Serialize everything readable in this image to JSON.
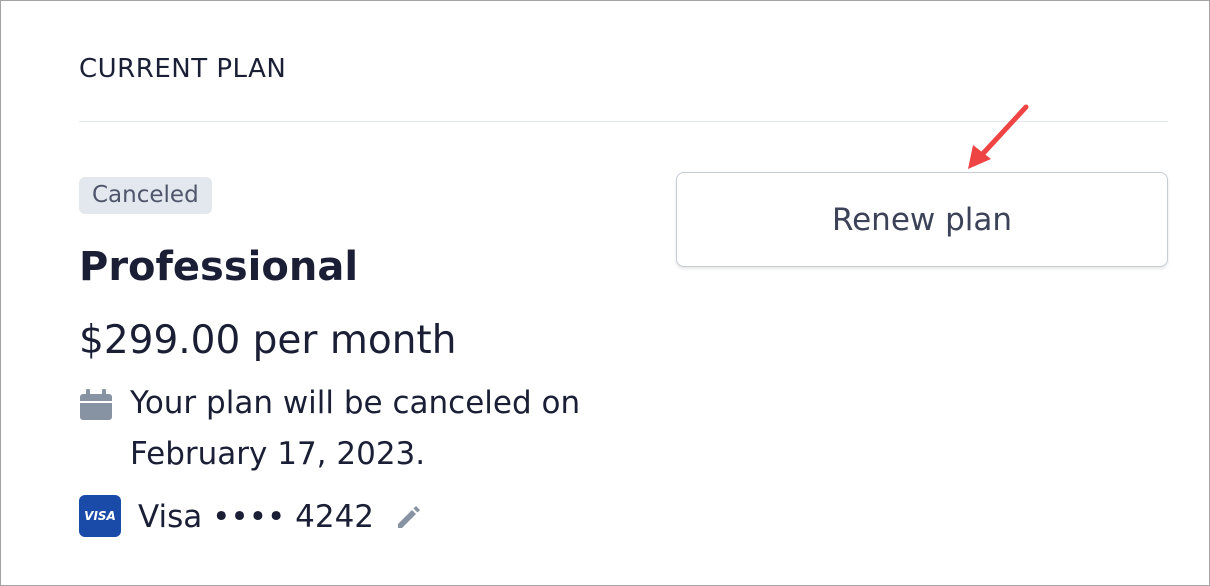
{
  "section": {
    "title": "CURRENT PLAN"
  },
  "plan": {
    "status_badge": "Canceled",
    "name": "Professional",
    "price": "$299.00 per month",
    "cancel_notice": "Your plan will be canceled on February 17, 2023."
  },
  "payment": {
    "card_brand_logo_text": "VISA",
    "card_label": "Visa •••• 4242"
  },
  "actions": {
    "renew_label": "Renew plan"
  },
  "icons": {
    "calendar": "calendar-icon",
    "edit": "pencil-icon",
    "arrow": "annotation-arrow"
  },
  "colors": {
    "text": "#1a1f36",
    "muted": "#4f566b",
    "badge_bg": "#e3e8ee",
    "visa_blue": "#1a4ba8",
    "arrow_red": "#ef4444"
  }
}
